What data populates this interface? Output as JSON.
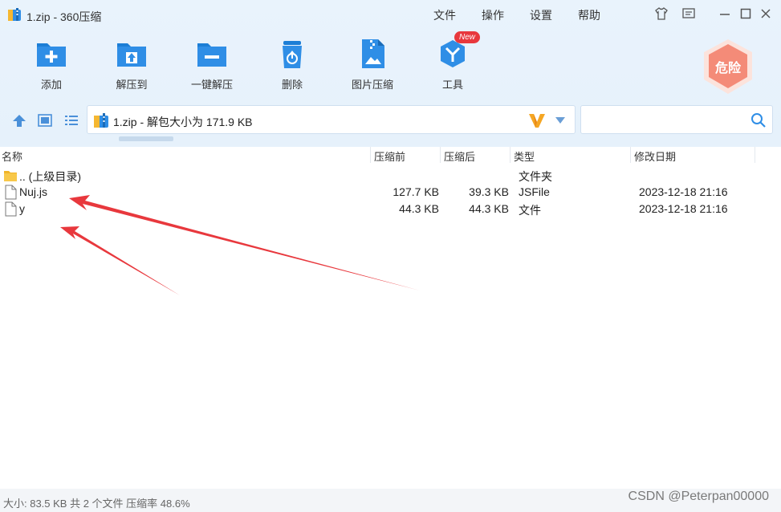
{
  "window": {
    "title": "1.zip - 360压缩",
    "menu": [
      "文件",
      "操作",
      "设置",
      "帮助"
    ]
  },
  "toolbar": {
    "buttons": [
      {
        "label": "添加",
        "icon": "add-folder-icon"
      },
      {
        "label": "解压到",
        "icon": "extract-folder-icon"
      },
      {
        "label": "一键解压",
        "icon": "one-click-extract-icon"
      },
      {
        "label": "删除",
        "icon": "recycle-bin-icon"
      },
      {
        "label": "图片压缩",
        "icon": "image-compress-icon"
      },
      {
        "label": "工具",
        "icon": "tools-icon"
      }
    ],
    "new_badge": "New",
    "danger_label": "危险"
  },
  "address": {
    "text": "1.zip - 解包大小为 171.9 KB",
    "search_placeholder": ""
  },
  "columns": {
    "name": "名称",
    "size": "压缩前",
    "compressed": "压缩后",
    "type": "类型",
    "modified": "修改日期"
  },
  "files": [
    {
      "name": ".. (上级目录)",
      "size": "",
      "compressed": "",
      "type": "文件夹",
      "modified": "",
      "icon": "folder-icon"
    },
    {
      "name": "Nuj.js",
      "size": "127.7 KB",
      "compressed": "39.3 KB",
      "type": "JSFile",
      "modified": "2023-12-18 21:16",
      "icon": "file-icon"
    },
    {
      "name": "y",
      "size": "44.3 KB",
      "compressed": "44.3 KB",
      "type": "文件",
      "modified": "2023-12-18 21:16",
      "icon": "file-icon"
    }
  ],
  "status": {
    "text": "大小: 83.5 KB 共 2 个文件 压缩率 48.6%",
    "watermark": "CSDN @Peterpan00000"
  },
  "colors": {
    "accent": "#2f8ee6",
    "background": "#e8f2fc",
    "arrow": "#e8383d"
  }
}
